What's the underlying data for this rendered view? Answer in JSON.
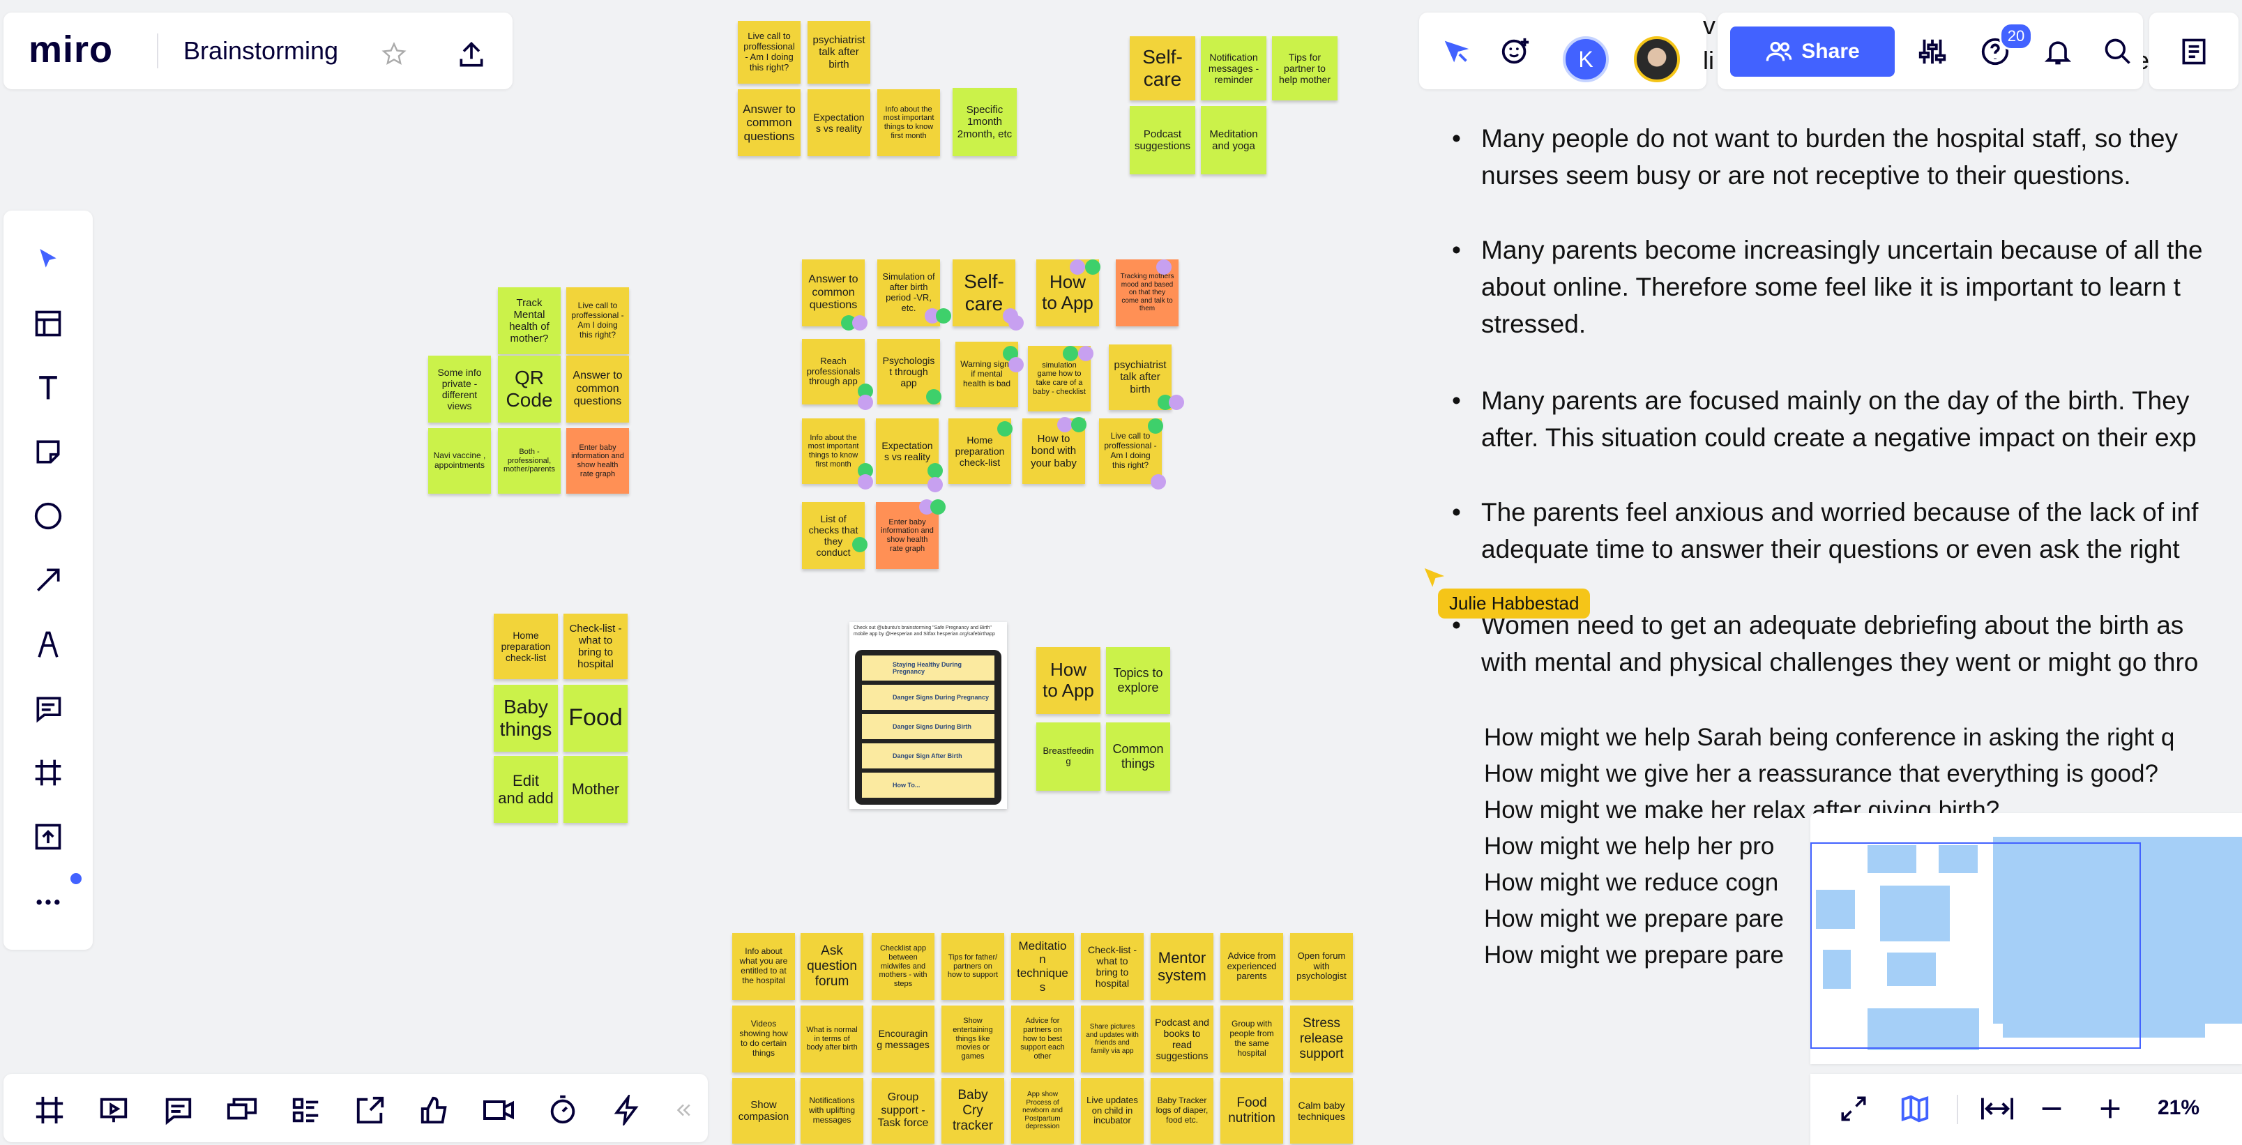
{
  "app": {
    "logo": "miro",
    "board_title": "Brainstorming"
  },
  "header": {
    "share_label": "Share",
    "notifications_count": "20",
    "avatar_initial": "K"
  },
  "bottom": {
    "zoom": "21%"
  },
  "cursor": {
    "user": "Julie Habbestad"
  },
  "text_panel": {
    "top_fragments": [
      "v",
      "li",
      "g",
      "ne"
    ],
    "bullets": [
      {
        "l1": "Many people do not want to burden the hospital staff, so they",
        "l2": "nurses seem busy or are not receptive to their questions.",
        "l3": ""
      },
      {
        "l1": "Many parents become increasingly uncertain because of all the",
        "l2": "about online. Therefore some feel like it is important to learn t",
        "l3": "stressed."
      },
      {
        "l1": "Many parents are focused mainly on the day of the birth. They",
        "l2": "after. This situation could create a negative impact on their exp",
        "l3": ""
      },
      {
        "l1": "The parents feel anxious and worried because of the lack of inf",
        "l2": "adequate time to answer their questions or even ask the right",
        "l3": ""
      },
      {
        "l1": "Women need to get an adequate debriefing about the birth as",
        "l2": "with mental and physical challenges they went or might go thro",
        "l3": ""
      }
    ],
    "hmw": [
      "How might we help Sarah being conference in asking the right q",
      "How might we give her a reassurance that everything is good?",
      "How might we make her relax after giving birth?",
      "How might we help her pro",
      "How might we reduce cogn",
      "How might we prepare pare",
      "How might we prepare pare"
    ]
  },
  "app_card": {
    "caption": "Check out @ubuntu's brainstorming \"Safe Pregnancy and Birth\" mobile app by @Hesperian and Sitfax hesperian.org/safebirthapp",
    "items": [
      "Staying Healthy During Pregnancy",
      "Danger Signs During Pregnancy",
      "Danger Signs During Birth",
      "Danger Sign After Birth",
      "How To..."
    ]
  },
  "notes": {
    "top1": [
      "Live call to proffessional - Am I doing this right?",
      "psychiatrist talk after birth",
      "Answer to common questions",
      "Expectations vs reality",
      "Info about the most important things to know first month",
      "Specific 1month 2month, etc"
    ],
    "top2": [
      "Self-care",
      "Notification messages - reminder",
      "Tips for partner to help mother",
      "Podcast suggestions",
      "Meditation and yoga"
    ],
    "left1": [
      "Track Mental health of mother?",
      "Live call to proffessional - Am I doing this right?",
      "Some info private - different views",
      "QR Code",
      "Answer to common questions",
      "Navi vaccine , appointments",
      "Both - professional, mother/parents",
      "Enter baby information and show health rate graph"
    ],
    "center": [
      "Answer to common questions",
      "Simulation of after birth period -VR, etc.",
      "Self-care",
      "How to App",
      "Tracking mothers mood and based on that they come and talk to them",
      "Reach professionals through app",
      "Psychologist through app",
      "Warning signs if mental health is bad",
      "simulation game how to take care of a baby - checklist",
      "psychiatrist talk after birth",
      "Info about the most important things to know first month",
      "Expectations vs reality",
      "Home preparation check-list",
      "How to bond with your baby",
      "Live call to proffessional - Am I doing this right?",
      "List of checks that they conduct",
      "Enter baby information and show health rate graph"
    ],
    "left2": [
      "Home preparation check-list",
      "Check-list - what to bring to hospital",
      "Baby things",
      "Food",
      "Edit and add",
      "Mother"
    ],
    "mid2": [
      "How to App",
      "Topics to explore",
      "Breastfeeding",
      "Common things"
    ],
    "bottom": [
      "Info about what you are entitled to at the hospital",
      "Ask question forum",
      "Checklist app between midwifes and mothers - with steps",
      "Tips for father/ partners on how to support",
      "Meditation techniques",
      "Check-list - what to bring to hospital",
      "Mentor system",
      "Advice from experienced parents",
      "Open forum with psychologist",
      "Videos showing how to do certain things",
      "What is normal in terms of body after birth",
      "Encouraging messages",
      "Show entertaining things like movies or games",
      "Advice for partners on how to best support each other",
      "Share pictures and updates with friends and family via app",
      "Podcast and books to read suggestions",
      "Group with people from the same hospital",
      "Stress release support",
      "Show compasion",
      "Notifications with uplifting messages",
      "Group support - Task force",
      "Baby Cry tracker",
      "App show Process of newborn and Postpartum depression",
      "Live updates on child in incubator",
      "Baby Tracker logs of diaper, food etc.",
      "Food nutrition",
      "Calm baby techniques"
    ]
  },
  "colors": {
    "accent": "#4262ff",
    "yellow": "#f2d43a",
    "green": "#cbf24a",
    "orange": "#ff9055",
    "minimap": "#a5cff7"
  }
}
